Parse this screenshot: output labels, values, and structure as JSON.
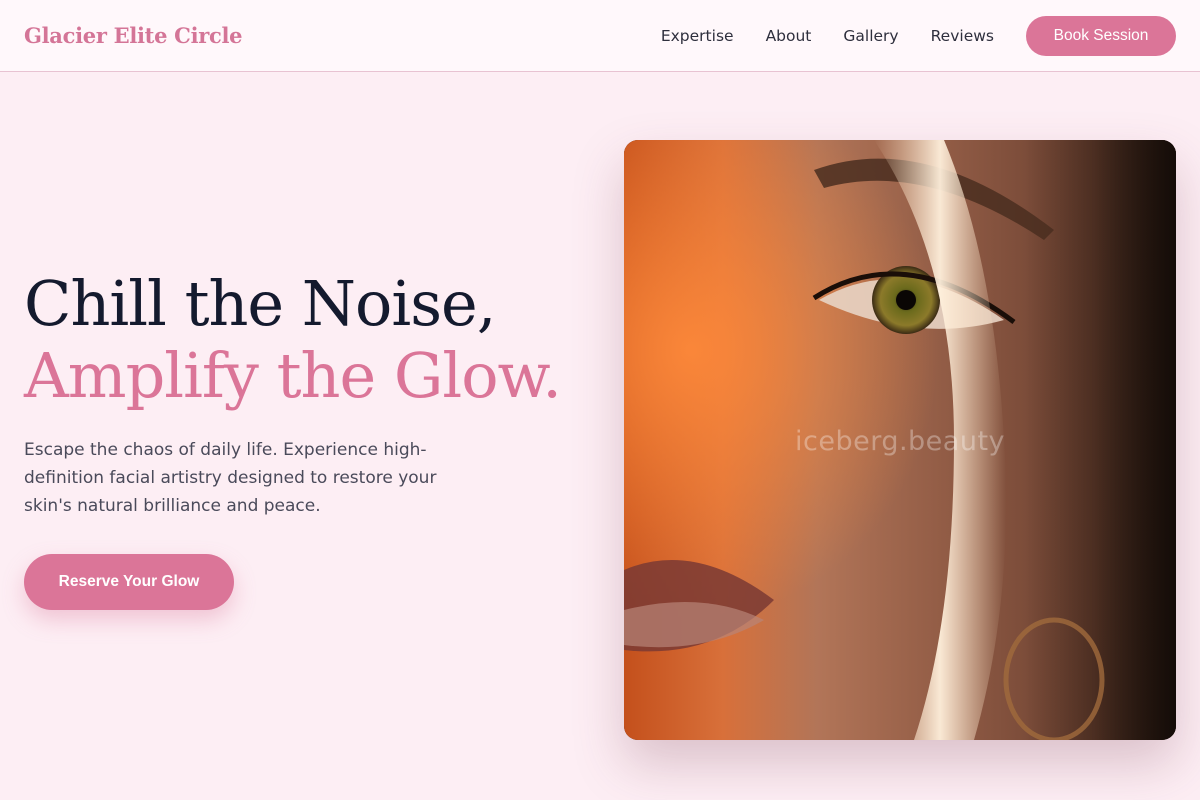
{
  "brand": {
    "name": "Glacier Elite Circle"
  },
  "nav": {
    "links": [
      "Expertise",
      "About",
      "Gallery",
      "Reviews"
    ],
    "cta_label": "Book Session"
  },
  "hero": {
    "headline_line1": "Chill the Noise,",
    "headline_line2": "Amplify the Glow.",
    "subtext": "Escape the chaos of daily life. Experience high-definition facial artistry designed to restore your skin's natural brilliance and peace.",
    "cta_label": "Reserve Your Glow",
    "image_watermark": "iceberg.beauty"
  },
  "colors": {
    "accent": "#db7598",
    "background": "#fdeef4",
    "heading": "#141a2e"
  }
}
